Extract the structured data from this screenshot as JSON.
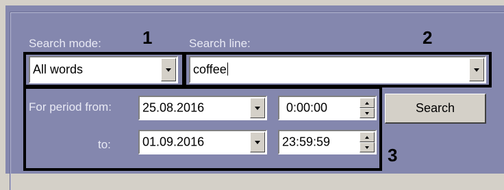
{
  "search_mode": {
    "label": "Search mode:",
    "value": "All words"
  },
  "search_line": {
    "label": "Search line:",
    "value": "coffee"
  },
  "period": {
    "from_label": "For period from:",
    "to_label": "to:",
    "from_date": "25.08.2016",
    "from_time": "0:00:00",
    "to_date": "01.09.2016",
    "to_time": "23:59:59"
  },
  "search_button": "Search",
  "callouts": {
    "one": "1",
    "two": "2",
    "three": "3"
  },
  "colors": {
    "panel": "#8487ae",
    "label_text": "#e9eaf5",
    "callout_border": "#000000"
  }
}
